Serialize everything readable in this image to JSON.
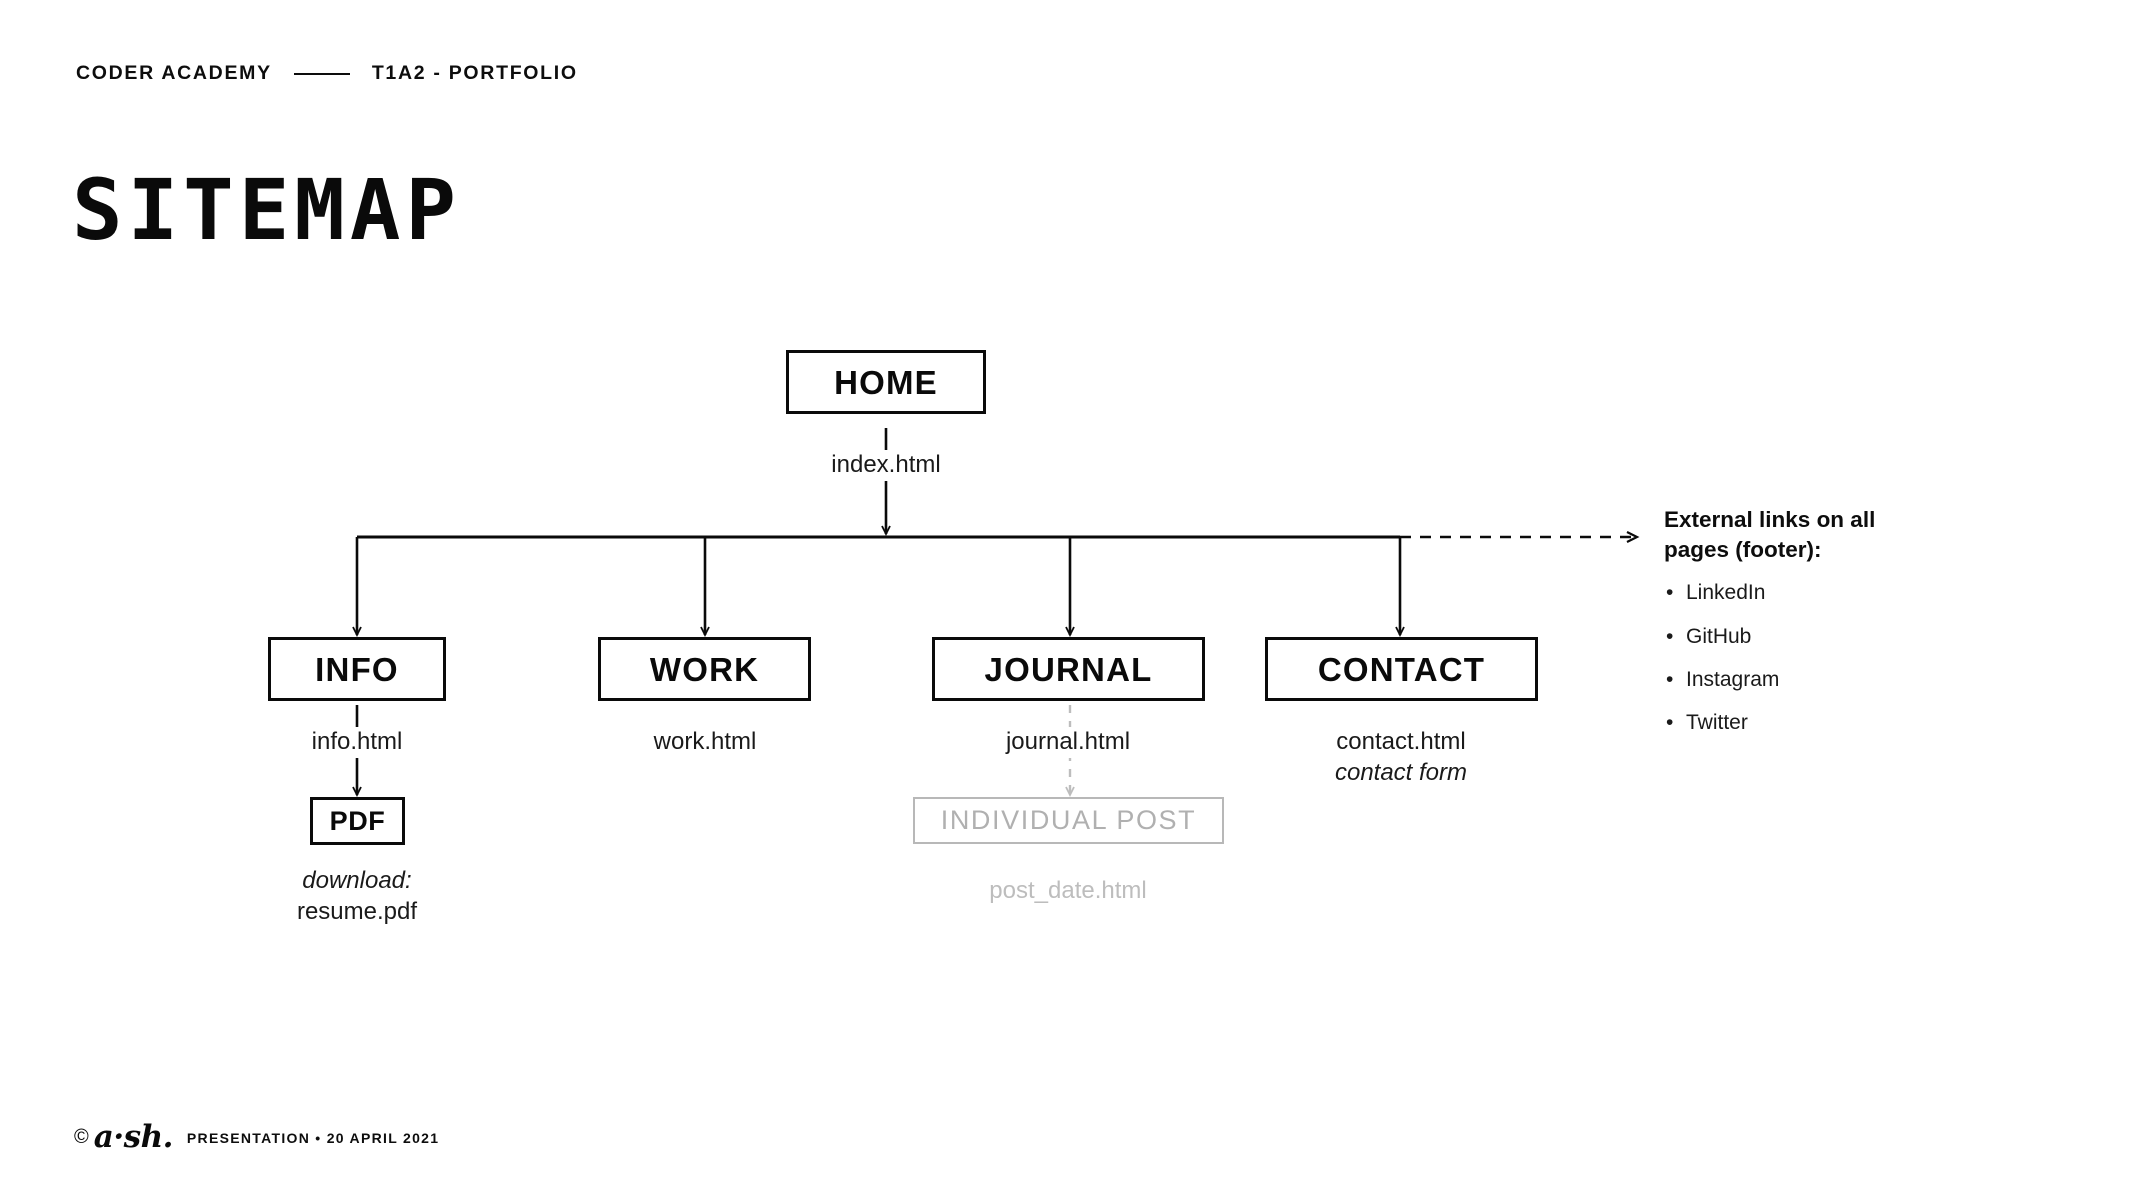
{
  "header": {
    "brand": "CODER ACADEMY",
    "project": "T1A2 - PORTFOLIO"
  },
  "title": "SITEMAP",
  "diagram": {
    "root": {
      "label": "HOME",
      "file": "index.html"
    },
    "branches": [
      {
        "label": "INFO",
        "file": "info.html"
      },
      {
        "label": "WORK",
        "file": "work.html"
      },
      {
        "label": "JOURNAL",
        "file": "journal.html"
      },
      {
        "label": "CONTACT",
        "file": "contact.html",
        "note": "contact form"
      }
    ],
    "leaves": [
      {
        "label": "PDF",
        "note": "download:",
        "file": "resume.pdf"
      },
      {
        "label": "INDIVIDUAL POST",
        "file": "post_date.html"
      }
    ]
  },
  "external": {
    "heading": "External links on all pages (footer):",
    "bullet": "•",
    "items": [
      "LinkedIn",
      "GitHub",
      "Instagram",
      "Twitter"
    ]
  },
  "footer": {
    "copyright": "©",
    "logo": "a·sh.",
    "meta": "PRESENTATION  •  20 APRIL 2021"
  },
  "colors": {
    "ink": "#0a0a0a",
    "muted": "#b8b8b8",
    "background": "#ffffff"
  }
}
